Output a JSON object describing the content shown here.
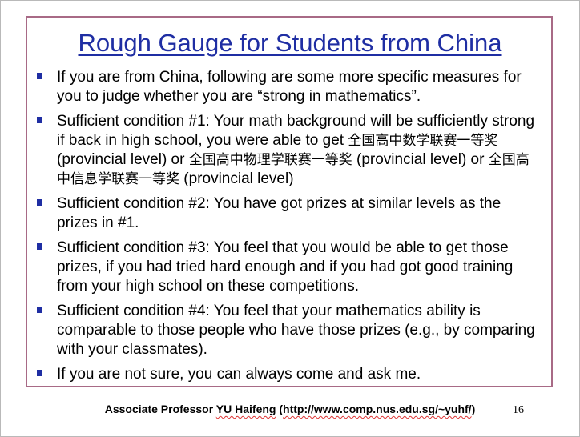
{
  "slide": {
    "title": "Rough Gauge for Students from China",
    "bullets": [
      {
        "parts": [
          {
            "text": "If you are from China, following are some more specific measures for you to judge whether you are “strong in mathematics”.",
            "cjk": false
          }
        ]
      },
      {
        "parts": [
          {
            "text": "Sufficient condition #1: Your math background will be sufficiently strong if back in high school, you were able to get ",
            "cjk": false
          },
          {
            "text": "全国高中数学联赛一等奖",
            "cjk": true
          },
          {
            "text": " (provincial level) or ",
            "cjk": false
          },
          {
            "text": "全国高中物理学联赛一等奖",
            "cjk": true
          },
          {
            "text": " (provincial level) or ",
            "cjk": false
          },
          {
            "text": "全国高中信息学联赛一等奖",
            "cjk": true
          },
          {
            "text": " (provincial level)",
            "cjk": false
          }
        ]
      },
      {
        "parts": [
          {
            "text": "Sufficient condition #2: You have got prizes at similar levels as the prizes in #1.",
            "cjk": false
          }
        ]
      },
      {
        "parts": [
          {
            "text": "Sufficient condition #3: You feel that you would be able to get those prizes, if you had tried hard enough and if you had got good training from your high school on these competitions.",
            "cjk": false
          }
        ]
      },
      {
        "parts": [
          {
            "text": "Sufficient condition #4: You feel that your mathematics ability is comparable to those people who have those prizes (e.g., by comparing with your classmates).",
            "cjk": false
          }
        ]
      },
      {
        "parts": [
          {
            "text": "If you are not sure, you can always come and ask me.",
            "cjk": false
          }
        ]
      }
    ],
    "footer": {
      "prefix": "Associate Professor ",
      "name": "YU Haifeng",
      "middle": " (",
      "url": "http://www.comp.nus.edu.sg/~yuhf/",
      "suffix": ")"
    },
    "page_number": "16",
    "colors": {
      "title": "#1f2ea3",
      "bullet": "#1f2ea3",
      "frame": "#a86a86"
    }
  }
}
